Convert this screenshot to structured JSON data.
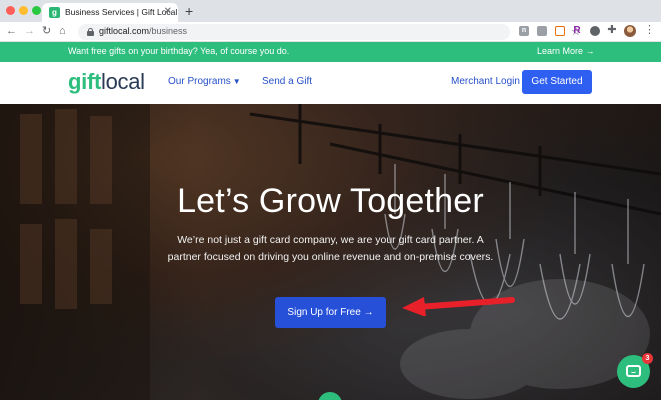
{
  "browser": {
    "tab": {
      "favicon_letter": "g",
      "title": "Business Services | Gift Local",
      "close_glyph": "✕"
    },
    "new_tab_glyph": "+",
    "url_host": "giftlocal.com",
    "url_path": "/business",
    "extensions": [
      "n",
      "",
      "",
      "R",
      "",
      "✦"
    ]
  },
  "promo_banner": {
    "message": "Want free gifts on your birthday? Yea, of course you do.",
    "link_label": "Learn More →"
  },
  "header": {
    "logo_part1": "gift",
    "logo_part2": "local",
    "nav": {
      "programs": "Our Programs",
      "send_gift": "Send a Gift",
      "merchant_login": "Merchant Login"
    },
    "cta": "Get Started"
  },
  "hero": {
    "title": "Let’s Grow Together",
    "subtitle": "We’re not just a gift card company, we are your gift card partner. A partner focused on driving you online revenue and on-premise covers.",
    "button": "Sign Up for Free →"
  },
  "chat": {
    "badge_count": "3"
  },
  "colors": {
    "brand_green": "#2dbe7e",
    "brand_blue": "#2f5ff0",
    "nav_blue": "#2750c8",
    "annotation_red": "#e8202a"
  }
}
